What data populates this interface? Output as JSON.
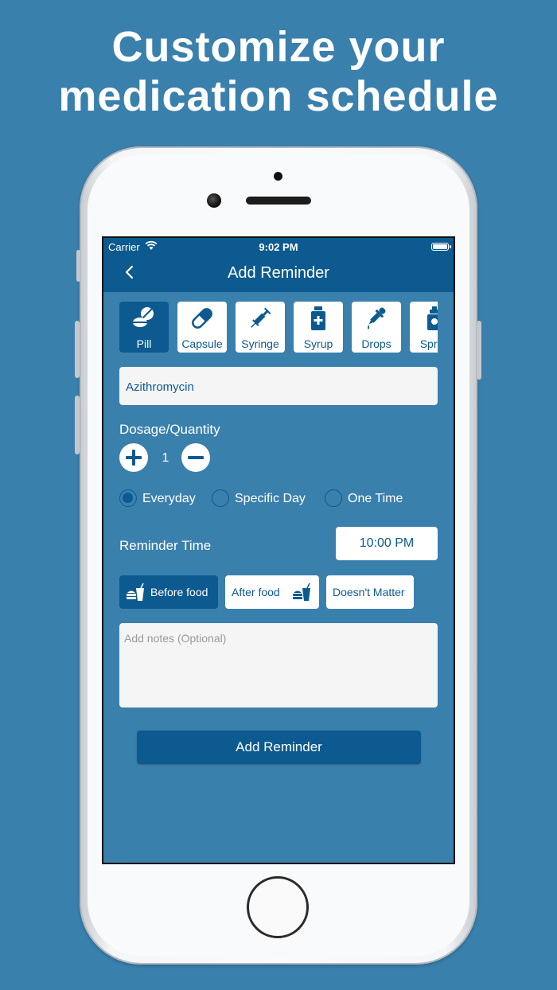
{
  "headline": [
    "Customize your",
    "medication schedule"
  ],
  "status_bar": {
    "carrier": "Carrier",
    "time": "9:02 PM"
  },
  "nav": {
    "title": "Add Reminder"
  },
  "med_types": [
    {
      "label": "Pill",
      "icon": "pill-icon",
      "selected": true
    },
    {
      "label": "Capsule",
      "icon": "capsule-icon",
      "selected": false
    },
    {
      "label": "Syringe",
      "icon": "syringe-icon",
      "selected": false
    },
    {
      "label": "Syrup",
      "icon": "syrup-icon",
      "selected": false
    },
    {
      "label": "Drops",
      "icon": "dropper-icon",
      "selected": false
    },
    {
      "label": "Spray",
      "icon": "spray-icon",
      "selected": false
    }
  ],
  "medicine_name": "Azithromycin",
  "dosage": {
    "label": "Dosage/Quantity",
    "value": "1"
  },
  "frequency": {
    "options": [
      "Everyday",
      "Specific Day",
      "One Time"
    ],
    "selected": "Everyday"
  },
  "reminder_time": {
    "label": "Reminder Time",
    "value": "10:00 PM"
  },
  "food_options": {
    "before": "Before food",
    "after": "After food",
    "doesnt_matter": "Doesn't Matter",
    "selected": "Before food"
  },
  "notes": {
    "placeholder": "Add notes (Optional)"
  },
  "submit": {
    "label": "Add Reminder"
  },
  "colors": {
    "background": "#3a80ad",
    "primary": "#0c5a8f",
    "field": "#f5f5f5"
  }
}
